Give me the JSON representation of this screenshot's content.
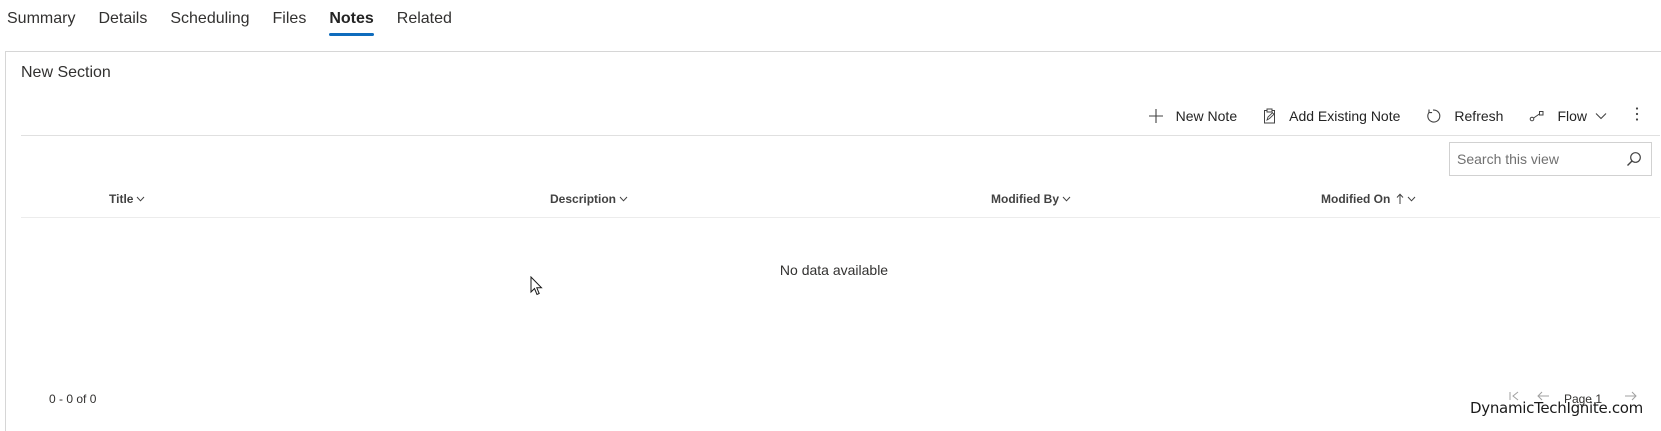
{
  "tabs": [
    {
      "label": "Summary",
      "active": false
    },
    {
      "label": "Details",
      "active": false
    },
    {
      "label": "Scheduling",
      "active": false
    },
    {
      "label": "Files",
      "active": false
    },
    {
      "label": "Notes",
      "active": true
    },
    {
      "label": "Related",
      "active": false
    }
  ],
  "section": {
    "title": "New Section"
  },
  "commands": {
    "new_note": "New Note",
    "add_existing_note": "Add Existing Note",
    "refresh": "Refresh",
    "flow": "Flow"
  },
  "search": {
    "placeholder": "Search this view",
    "value": ""
  },
  "grid": {
    "columns": [
      {
        "label": "Title",
        "sort": "none"
      },
      {
        "label": "Description",
        "sort": "none"
      },
      {
        "label": "Modified By",
        "sort": "none"
      },
      {
        "label": "Modified On",
        "sort": "ascending"
      }
    ],
    "empty_message": "No data available",
    "record_count": "0 - 0 of 0",
    "page_label": "Page 1"
  },
  "watermark": "DynamicTechIgnite.com",
  "colors": {
    "accent": "#0f6cbd",
    "text": "#242424",
    "border": "#d6d6d6"
  }
}
